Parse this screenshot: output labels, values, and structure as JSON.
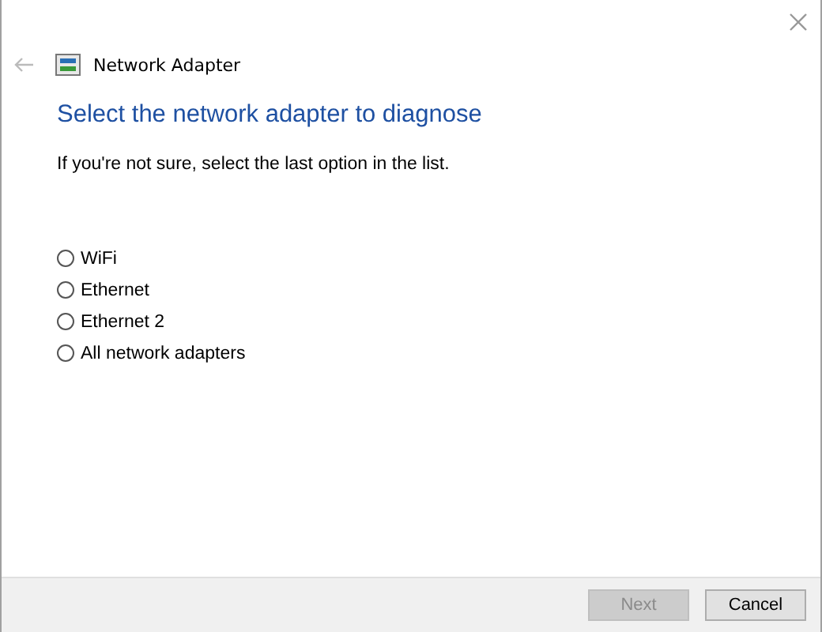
{
  "window": {
    "title": "Network Adapter"
  },
  "heading": "Select the network adapter to diagnose",
  "instruction": "If you're not sure, select the last option in the list.",
  "options": [
    {
      "label": "WiFi",
      "selected": false
    },
    {
      "label": "Ethernet",
      "selected": false
    },
    {
      "label": "Ethernet 2",
      "selected": false
    },
    {
      "label": "All network adapters",
      "selected": false
    }
  ],
  "buttons": [
    {
      "label": "Next",
      "disabled": true
    },
    {
      "label": "Cancel",
      "disabled": false
    }
  ]
}
